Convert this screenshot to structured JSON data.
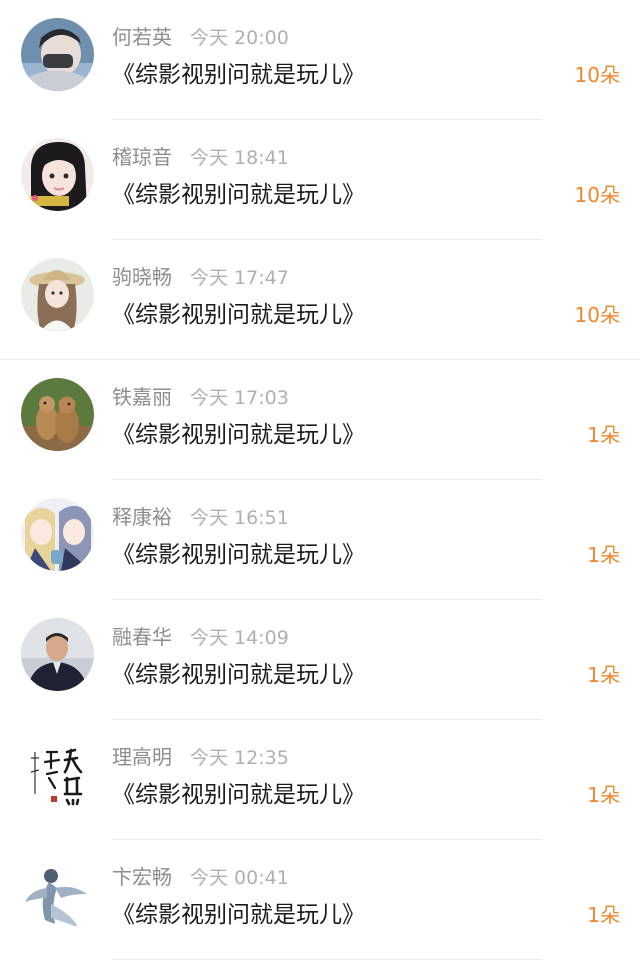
{
  "gift_records": [
    {
      "name": "何若英",
      "time": "今天 20:00",
      "title": "《综影视别问就是玩儿》",
      "gift": "10朵",
      "avatar": "person-with-mask"
    },
    {
      "name": "稽琼音",
      "time": "今天 18:41",
      "title": "《综影视别问就是玩儿》",
      "gift": "10朵",
      "avatar": "girl-with-bangs"
    },
    {
      "name": "驹晓畅",
      "time": "今天 17:47",
      "title": "《综影视别问就是玩儿》",
      "gift": "10朵",
      "avatar": "girl-with-straw-hat"
    },
    {
      "name": "铁嘉丽",
      "time": "今天 17:03",
      "title": "《综影视别问就是玩儿》",
      "gift": "1朵",
      "avatar": "prairie-dogs"
    },
    {
      "name": "释康裕",
      "time": "今天 16:51",
      "title": "《综影视别问就是玩儿》",
      "gift": "1朵",
      "avatar": "anime-characters"
    },
    {
      "name": "融春华",
      "time": "今天 14:09",
      "title": "《综影视别问就是玩儿》",
      "gift": "1朵",
      "avatar": "man-in-jacket"
    },
    {
      "name": "理高明",
      "time": "今天 12:35",
      "title": "《综影视别问就是玩儿》",
      "gift": "1朵",
      "avatar": "calligraphy"
    },
    {
      "name": "卞宏畅",
      "time": "今天 00:41",
      "title": "《综影视别问就是玩儿》",
      "gift": "1朵",
      "avatar": "ink-figure"
    }
  ]
}
